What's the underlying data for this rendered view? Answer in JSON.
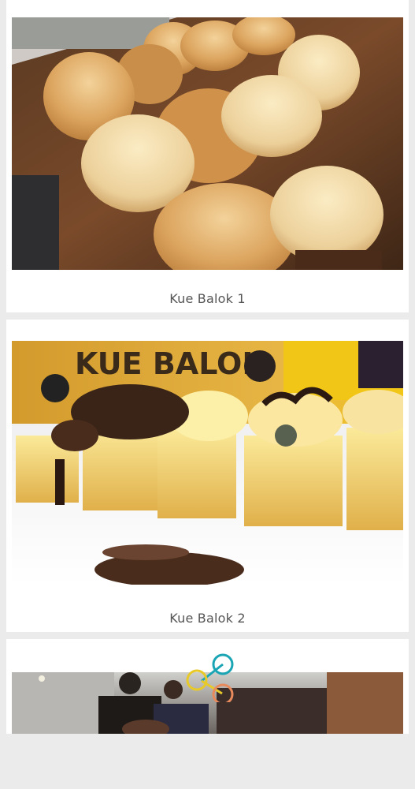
{
  "feed": {
    "items": [
      {
        "caption": "Kue Balok 1",
        "photo": "baked-cakes-on-wooden-board"
      },
      {
        "caption": "Kue Balok 2",
        "photo": "topped-cakes-on-plate",
        "photo_text": "KUE BALOK"
      },
      {
        "caption": "",
        "photo": "restaurant-interior"
      }
    ]
  },
  "share_icon": {
    "name": "share-icon",
    "colors": [
      "#1aa5b5",
      "#e8c92a",
      "#e98a5c"
    ]
  },
  "colors": {
    "background": "#ebebeb",
    "card": "#ffffff",
    "caption": "#555555"
  }
}
